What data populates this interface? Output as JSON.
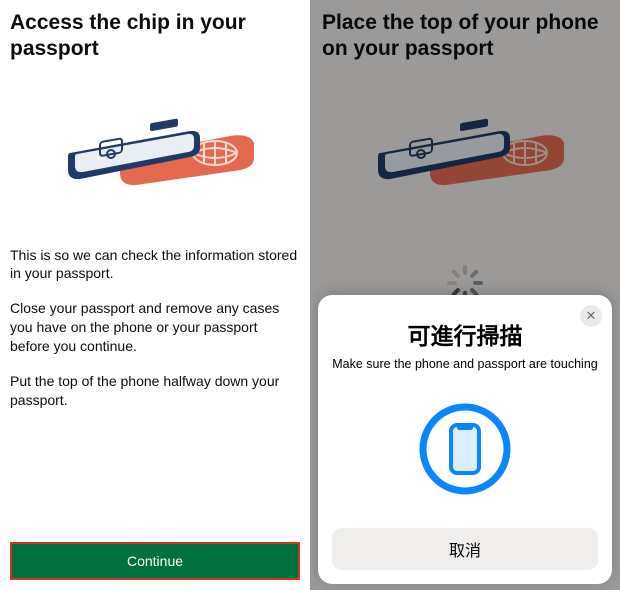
{
  "left": {
    "title": "Access the chip in your passport",
    "para1": "This is so we can check the information stored in your passport.",
    "para2": "Close your passport and remove any cases you have on the phone or your passport before you continue.",
    "para3": "Put the top of the phone halfway down your passport.",
    "continue_label": "Continue"
  },
  "right": {
    "title": "Place the top of your phone on your passport",
    "sheet": {
      "title": "可進行掃描",
      "subtitle": "Make sure the phone and passport are touching",
      "cancel_label": "取消",
      "close_glyph": "✕"
    }
  },
  "colors": {
    "primary_button": "#00703c",
    "highlight_border": "#d4351c",
    "nfc_ring": "#0a84ff"
  }
}
